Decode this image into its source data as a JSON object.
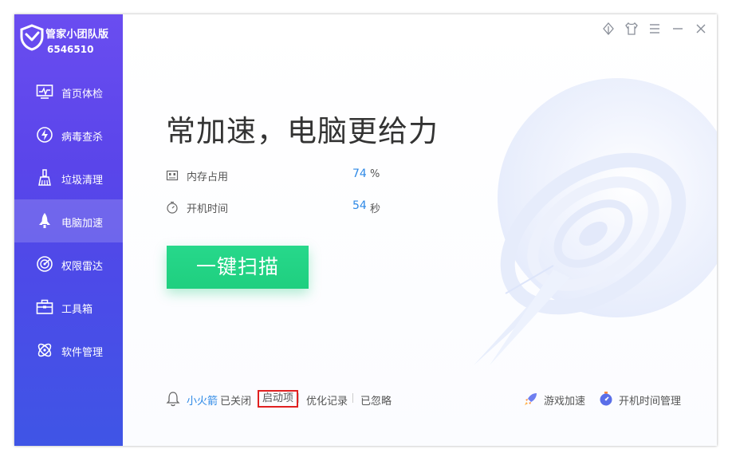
{
  "app": {
    "name": "管家小团队版",
    "uid": "6546510"
  },
  "sidebar": {
    "items": [
      {
        "label": "首页体检",
        "icon": "monitor-icon"
      },
      {
        "label": "病毒查杀",
        "icon": "virus-bolt-icon"
      },
      {
        "label": "垃圾清理",
        "icon": "broom-icon"
      },
      {
        "label": "电脑加速",
        "icon": "rocket-icon",
        "active": true
      },
      {
        "label": "权限雷达",
        "icon": "radar-icon"
      },
      {
        "label": "工具箱",
        "icon": "toolbox-icon"
      },
      {
        "label": "软件管理",
        "icon": "apps-icon"
      }
    ]
  },
  "main": {
    "headline": "常加速，电脑更给力",
    "stats": [
      {
        "label": "内存占用",
        "value": "74",
        "unit": "%",
        "icon": "memory-chip-icon"
      },
      {
        "label": "开机时间",
        "value": "54",
        "unit": "秒",
        "icon": "stopwatch-icon"
      }
    ],
    "scan_button": "一键扫描",
    "footer": {
      "rocket_name": "小火箭",
      "rocket_state": "已关闭",
      "startup": "启动项",
      "optimize_log": "优化记录",
      "ignored": "已忽略"
    },
    "tools": [
      {
        "label": "游戏加速",
        "icon": "game-rocket-icon"
      },
      {
        "label": "开机时间管理",
        "icon": "boot-timer-icon"
      }
    ]
  },
  "colors": {
    "accent_blue": "#2e89e6",
    "scan_green": "#1fcf7f",
    "sidebar_top": "#6a4df0",
    "sidebar_bottom": "#3f55e6",
    "highlight_red": "#e02020"
  }
}
